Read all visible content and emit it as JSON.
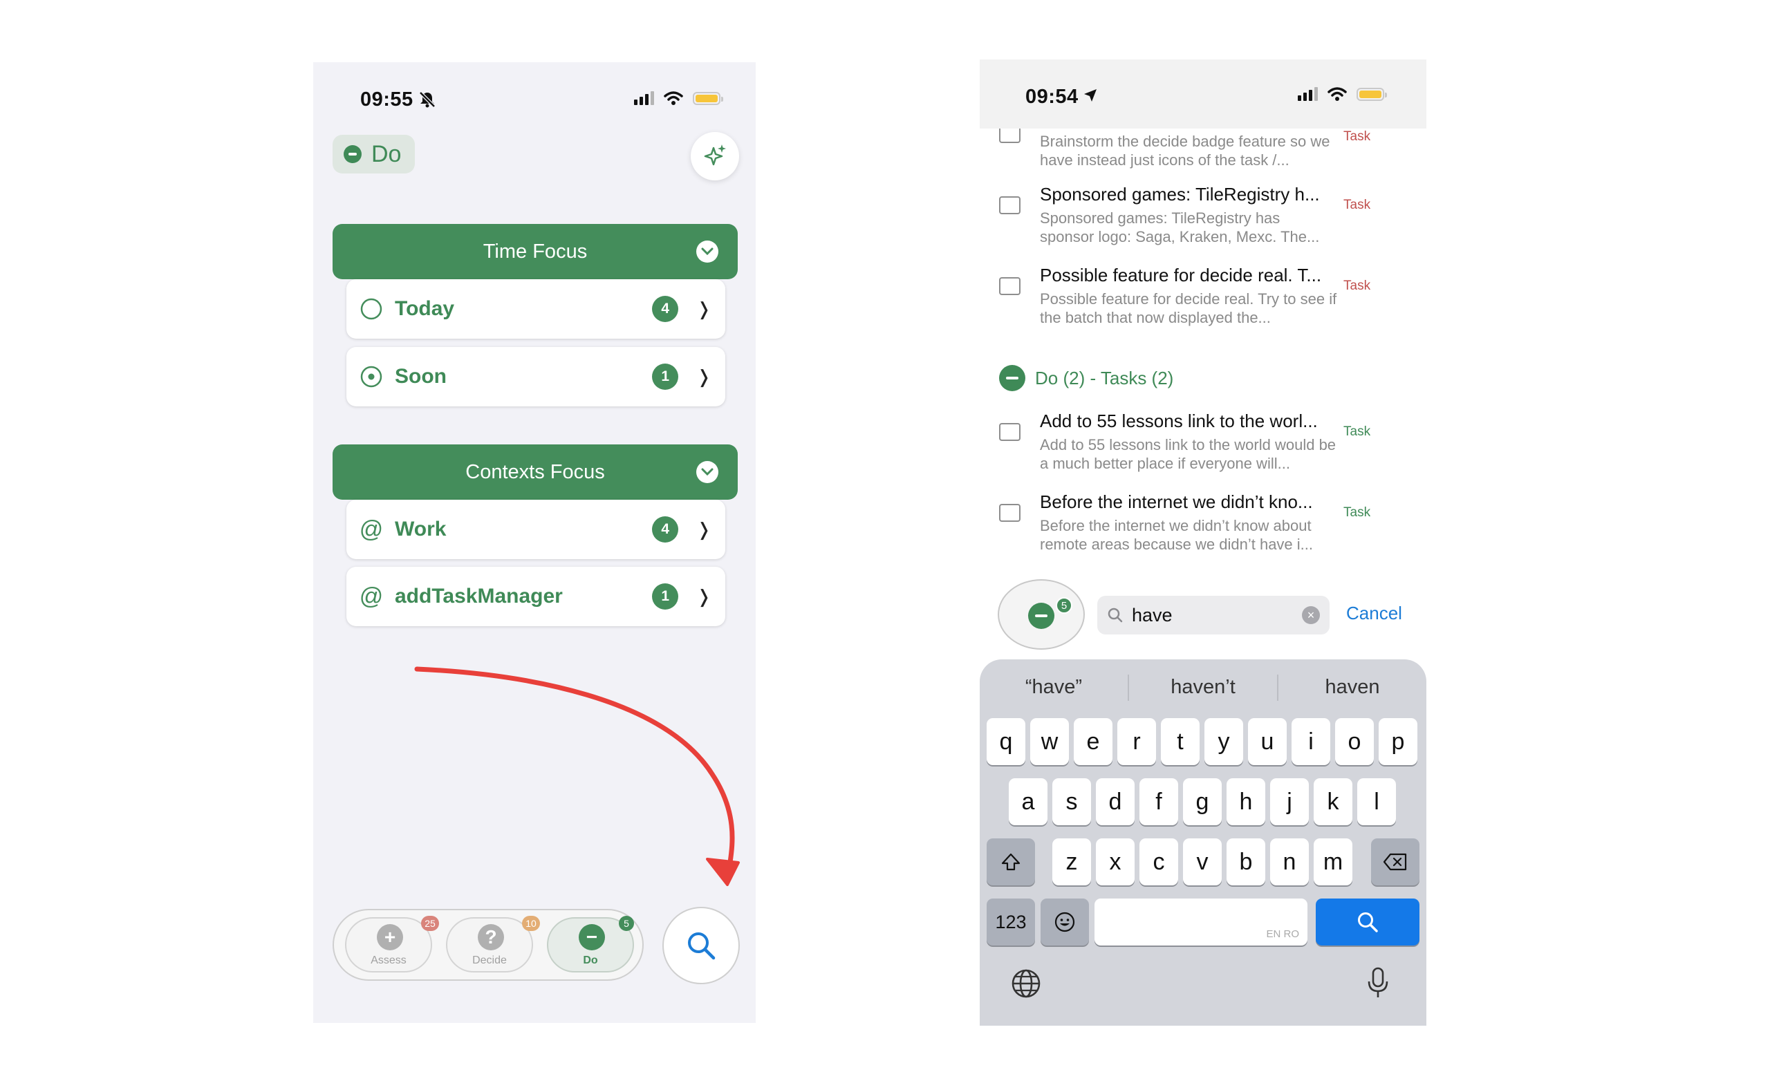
{
  "left_screen": {
    "status_bar": {
      "time": "09:55",
      "icons": [
        "bell-slash-icon",
        "signal-icon",
        "wifi-icon",
        "battery-icon"
      ]
    },
    "mode_pill": {
      "label": "Do",
      "icon": "minus-circle-icon"
    },
    "ai_button": {
      "icon": "sparkle-icon"
    },
    "time_focus": {
      "title": "Time Focus",
      "items": [
        {
          "label": "Today",
          "icon": "circle-icon",
          "count": "4"
        },
        {
          "label": "Soon",
          "icon": "circle-dot-icon",
          "count": "1"
        }
      ]
    },
    "contexts_focus": {
      "title": "Contexts Focus",
      "items": [
        {
          "label": "Work",
          "icon": "at-icon",
          "count": "4"
        },
        {
          "label": "addTaskManager",
          "icon": "at-icon",
          "count": "1"
        }
      ]
    },
    "tab_bar": {
      "tabs": [
        {
          "label": "Assess",
          "icon": "plus-icon",
          "badge": "25",
          "badge_color": "#d9847b"
        },
        {
          "label": "Decide",
          "icon": "question-icon",
          "badge": "10",
          "badge_color": "#e3ad74"
        },
        {
          "label": "Do",
          "icon": "minus-icon",
          "badge": "5",
          "badge_color": "#448d5b"
        }
      ]
    },
    "search_button": {
      "icon": "search-icon"
    }
  },
  "right_screen": {
    "status_bar": {
      "time": "09:54",
      "icons": [
        "location-arrow-icon",
        "signal-icon",
        "wifi-icon",
        "battery-icon"
      ]
    },
    "decide_tasks": [
      {
        "title": "",
        "description": "Brainstorm the decide badge feature so we have instead just icons of the task /...",
        "tag": "Task"
      },
      {
        "title": "Sponsored games: TileRegistry h...",
        "description": "Sponsored games: TileRegistry has sponsor logo: Saga, Kraken, Mexc. The...",
        "tag": "Task"
      },
      {
        "title": "Possible feature for decide real. T...",
        "description": "Possible feature for decide real. Try to see if the batch that now displayed the...",
        "tag": "Task"
      }
    ],
    "do_group": {
      "header": "Do (2) - Tasks (2)",
      "tasks": [
        {
          "title": "Add to 55 lessons link to the worl...",
          "description": "Add to 55 lessons link to the world would be a much better place if everyone will...",
          "tag": "Task"
        },
        {
          "title": "Before the internet we didn’t kno...",
          "description": "Before the internet we didn’t know about remote areas because we didn’t have i...",
          "tag": "Task"
        }
      ]
    },
    "fab_badge": "5",
    "search": {
      "value": "have",
      "cancel_label": "Cancel"
    },
    "keyboard": {
      "suggestions": [
        "“have”",
        "haven’t",
        "haven"
      ],
      "row1": [
        "q",
        "w",
        "e",
        "r",
        "t",
        "y",
        "u",
        "i",
        "o",
        "p"
      ],
      "row2": [
        "a",
        "s",
        "d",
        "f",
        "g",
        "h",
        "j",
        "k",
        "l"
      ],
      "row3": [
        "z",
        "x",
        "c",
        "v",
        "b",
        "n",
        "m"
      ],
      "numbers_key": "123",
      "space_hint": "EN RO",
      "icons": [
        "shift-icon",
        "backspace-icon",
        "emoji-icon",
        "search-icon",
        "globe-icon",
        "microphone-icon"
      ]
    }
  },
  "colors": {
    "accent_green": "#448d5b",
    "decide_tag_red": "#c0504d",
    "do_tag_green": "#3f8a57",
    "keyboard_blue": "#1479e8",
    "annotation_red": "#e8403a"
  }
}
